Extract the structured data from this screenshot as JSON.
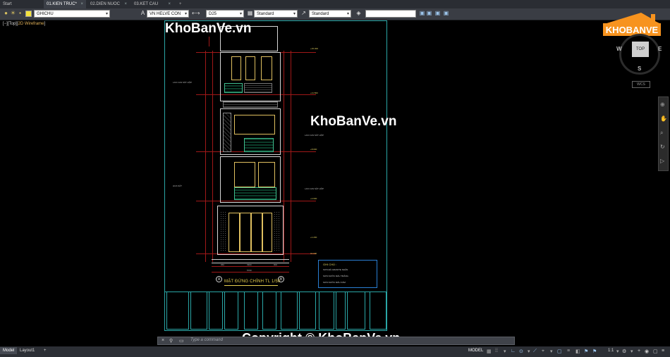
{
  "tabs": [
    {
      "label": "Start",
      "active": false
    },
    {
      "label": "01.KIEN TRUC*",
      "active": true
    },
    {
      "label": "02.DIEN NUOC",
      "active": false
    },
    {
      "label": "03.KET CAU",
      "active": false
    }
  ],
  "new_tab_symbol": "+",
  "toolbar": {
    "layer": "GHICHU",
    "text_style": "VN HELVE CON",
    "dim_style": "D25",
    "table_style": "Standard",
    "multileader_style": "Standard"
  },
  "viewport_label": {
    "prefix": "[−][Top][",
    "mode": "2D Wireframe",
    "suffix": "]"
  },
  "view_cube": {
    "face": "TOP",
    "north": "N",
    "west": "W",
    "east": "E",
    "south": "S",
    "wcs": "WCS"
  },
  "watermarks": {
    "top": "KhoBanVe.vn",
    "mid": "KhoBanVe.vn",
    "copyright": "Copyright © KhoBanVe.vn"
  },
  "logo": {
    "text": "KHOBANVE"
  },
  "drawing": {
    "title": "MẶT ĐỨNG CHÍNH TL 1/50",
    "axis_left": "A",
    "axis_right": "B",
    "dims_bottom": [
      "960",
      "3900",
      "900"
    ],
    "dim_total": "5760",
    "notes": {
      "title": "GHI CHÚ :",
      "items": [
        "SƠN ĐÁ GRANITE NHÂN",
        "SƠN NƯỚC MÀU TRẮNG",
        "SƠN NƯỚC MÀU XÁM"
      ]
    },
    "level_labels": [
      "+15.300",
      "+11.500",
      "+8.000",
      "+4.600",
      "+1.200",
      "±0.000"
    ],
    "side_notes": [
      "LAN CAN SẮT HỘP",
      "LAN CAN SẮT HỘP",
      "LAN CAN SẮT HỘP",
      "HOA SẮT"
    ]
  },
  "command_line": {
    "placeholder": "Type a command"
  },
  "status": {
    "layout_tabs": [
      {
        "label": "Model",
        "active": true
      },
      {
        "label": "Layout1",
        "active": false
      }
    ],
    "add_layout": "+",
    "mode": "MODEL",
    "scale": "1:1"
  }
}
